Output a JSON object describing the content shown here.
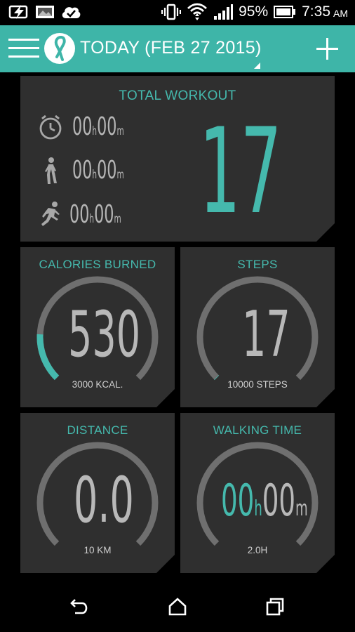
{
  "status_bar": {
    "battery": "95%",
    "time": "7:35",
    "ampm": "AM",
    "icons": [
      "lightning-icon",
      "image-icon",
      "cloud-check-icon",
      "vibrate-icon",
      "wifi-icon",
      "signal-icon",
      "battery-icon"
    ]
  },
  "app_bar": {
    "title": "TODAY (FEB 27 2015)",
    "menu_icon": "hamburger-menu-icon",
    "logo_icon": "ribbon-logo-icon",
    "add_icon": "plus-icon"
  },
  "total_workout": {
    "label": "TOTAL WORKOUT",
    "value": "17",
    "rows": [
      {
        "icon": "stopwatch-icon",
        "hours": "00",
        "minutes": "00",
        "h_unit": "h",
        "m_unit": "m"
      },
      {
        "icon": "walking-icon",
        "hours": "00",
        "minutes": "00",
        "h_unit": "h",
        "m_unit": "m"
      },
      {
        "icon": "running-icon",
        "hours": "00",
        "minutes": "00",
        "h_unit": "h",
        "m_unit": "m"
      }
    ]
  },
  "calories": {
    "label": "CALORIES BURNED",
    "value": "530",
    "goal": "3000 KCAL.",
    "progress": 0.1767
  },
  "steps": {
    "label": "STEPS",
    "value": "17",
    "goal": "10000 STEPS",
    "progress": 0.0017
  },
  "distance": {
    "label": "DISTANCE",
    "value": "0.0",
    "goal": "10 KM",
    "progress": 0
  },
  "walking_time": {
    "label": "WALKING TIME",
    "hours": "00",
    "minutes": "00",
    "h_unit": "h",
    "m_unit": "m",
    "goal": "2.0H",
    "progress": 0
  },
  "colors": {
    "accent": "#45b9ad",
    "app_bar": "#3eb5a8",
    "card": "#2f2f2f",
    "gauge_track": "#6f6f6f"
  },
  "nav_bar": {
    "back_icon": "back-icon",
    "home_icon": "home-icon",
    "recents_icon": "recents-icon"
  }
}
